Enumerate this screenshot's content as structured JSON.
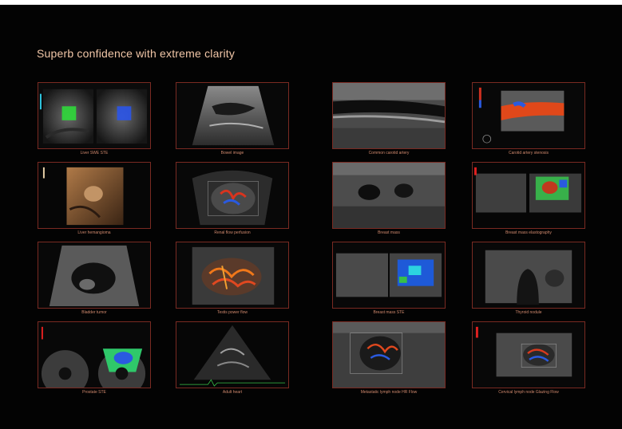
{
  "page": {
    "title": "Superb confidence with extreme clarity"
  },
  "captions": {
    "liver_sws": "Liver SWE STE",
    "bowel": "Bowel image",
    "carotid": "Common carotid artery",
    "carotid_stenosis": "Carotid artery stenosis",
    "liver_hemangioma": "Liver hemangioma",
    "renal": "Renal flow perfusion",
    "breast_mass": "Breast mass",
    "breast_elasto": "Breast mass elastography",
    "bladder": "Bladder tumor",
    "testis": "Testis power flow",
    "breast_ste": "Breast mass STE",
    "thyroid": "Thyroid nodule",
    "prostate": "Prostate STE",
    "adult_heart": "Adult heart",
    "lymph_hr": "Metastatic lymph node HR Flow",
    "cervical_lymph": "Cervical lymph node Glazing Flow"
  },
  "colors": {
    "background": "#030303",
    "title": "#f2c7a8",
    "frame_border": "#7a2a22",
    "caption": "#d28a6e"
  }
}
